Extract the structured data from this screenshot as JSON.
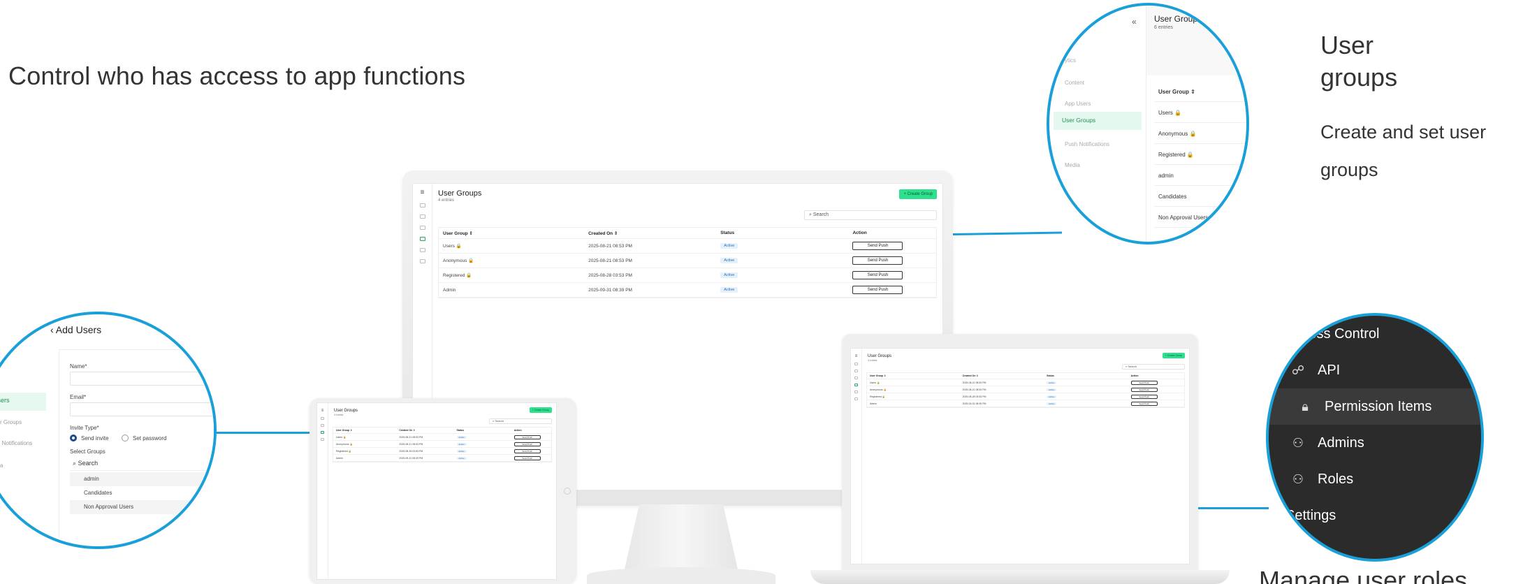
{
  "headline": "Control who has access to app functions",
  "user_groups_caption": {
    "title_line1": "User",
    "title_line2": "groups",
    "desc_line1": "Create and set user",
    "desc_line2": "groups"
  },
  "roles_caption": "Manage user roles",
  "app_screen": {
    "title": "User Groups",
    "subtitle": "4 entries",
    "create_button": "+ Create Group",
    "search_placeholder": "Search",
    "columns": [
      "User Group ⇕",
      "Created On ⇕",
      "Status",
      "Action"
    ],
    "rows": [
      {
        "name": "Users 🔒",
        "created": "2025-08-21 08:53 PM",
        "status": "Active",
        "action": "Send Push"
      },
      {
        "name": "Anonymous 🔒",
        "created": "2025-08-21 08:53 PM",
        "status": "Active",
        "action": "Send Push"
      },
      {
        "name": "Registered 🔒",
        "created": "2025-08-28 03:53 PM",
        "status": "Active",
        "action": "Send Push"
      },
      {
        "name": "Admin",
        "created": "2025-09-31 08:39 PM",
        "status": "Active",
        "action": "Send Push"
      }
    ]
  },
  "add_users": {
    "title": "Add Users",
    "sidebar_selected": "Users",
    "sidebar_items": [
      "r Groups",
      "h Notifications",
      "a"
    ],
    "name_label": "Name*",
    "email_label": "Email*",
    "invite_type_label": "Invite Type*",
    "invite_options": [
      "Send invite",
      "Set password"
    ],
    "select_groups_label": "Select Groups",
    "search_placeholder": "Search",
    "groups": [
      "admin",
      "Candidates",
      "Non Approval Users"
    ]
  },
  "groups_zoom": {
    "collapse_icon": "«",
    "title": "User Groups",
    "subtitle": "6 entries",
    "menu": [
      "ytics",
      "Content",
      "App Users",
      "User Groups",
      "Push Notifications",
      "Media"
    ],
    "menu_selected": "User Groups",
    "column_header": "User Group ⇕",
    "rows": [
      "Users 🔒",
      "Anonymous 🔒",
      "Registered 🔒",
      "admin",
      "Candidates",
      "Non Approval Users"
    ]
  },
  "access_control": {
    "items": [
      {
        "label": "Access Control",
        "icon": "arrow-icon"
      },
      {
        "label": "API",
        "icon": "network-icon"
      },
      {
        "label": "Permission Items",
        "icon": "lock-icon"
      },
      {
        "label": "Admins",
        "icon": "user-gear-icon"
      },
      {
        "label": "Roles",
        "icon": "user-lock-icon"
      },
      {
        "label": "Settings",
        "icon": "settings-icon"
      }
    ],
    "highlighted": "Permission Items"
  },
  "colors": {
    "accent_blue": "#1aa0d8",
    "create_green": "#2ee08e",
    "selected_green": "#1b8f57",
    "dark_panel": "#2b2b2b"
  }
}
